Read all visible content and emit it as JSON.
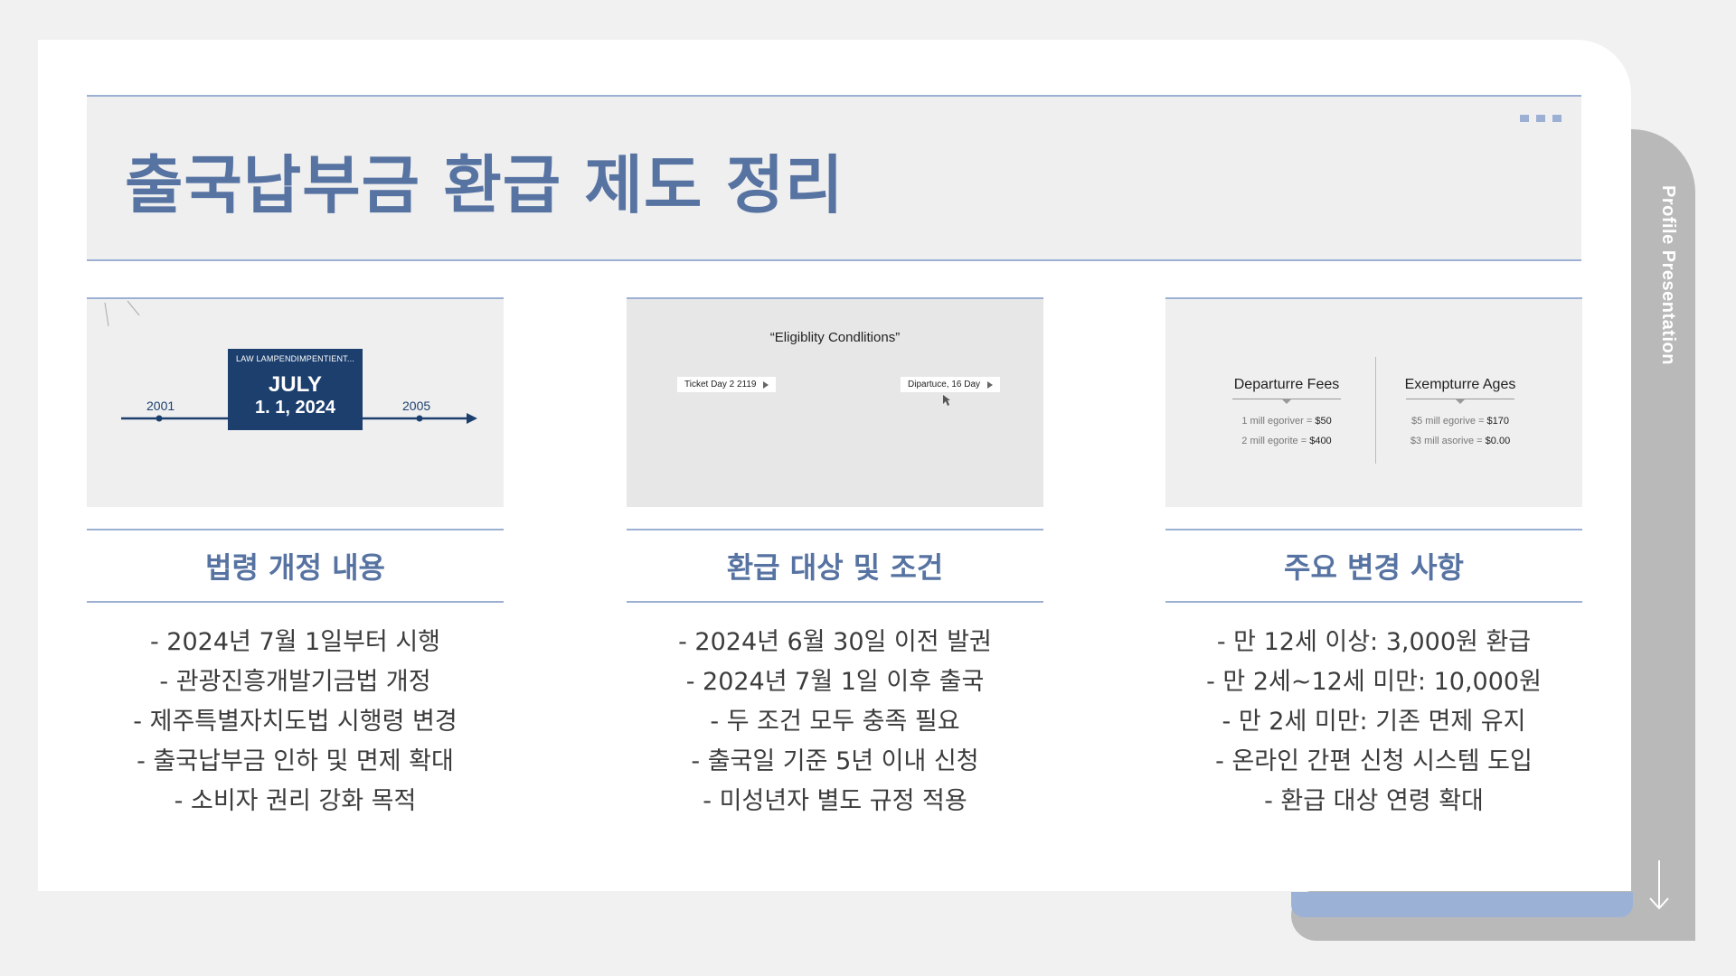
{
  "slide": {
    "title": "출국납부금 환급 제도 정리",
    "side_label": "Profile Presentation"
  },
  "columns": [
    {
      "heading": "법령 개정 내용",
      "items": [
        "- 2024년 7월 1일부터 시행",
        "- 관광진흥개발기금법 개정",
        "- 제주특별자치도법 시행령 변경",
        "- 출국납부금 인하 및 면제 확대",
        "- 소비자 권리 강화 목적"
      ],
      "thumbnail": {
        "box_top": "LAW LAMPENDIMPENTIENT...",
        "box_month": "JULY",
        "box_day": "1. 1, 2024",
        "year_left": "2001",
        "year_right": "2005"
      }
    },
    {
      "heading": "환급 대상 및 조건",
      "items": [
        "- 2024년 6월 30일 이전 발권",
        "- 2024년 7월 1일 이후 출국",
        "- 두 조건 모두 충족 필요",
        "- 출국일 기준 5년 이내 신청",
        "- 미성년자 별도 규정 적용"
      ],
      "thumbnail": {
        "quote": "“Eligiblity Condlitions”",
        "pill_left": "Ticket Day 2 2119",
        "pill_right": "Dipartuce, 16 Day"
      }
    },
    {
      "heading": "주요 변경 사항",
      "items": [
        "- 만 12세 이상: 3,000원 환급",
        "- 만 2세~12세 미만: 10,000원",
        "- 만 2세 미만: 기존 면제 유지",
        "- 온라인 간편 신청 시스템 도입",
        "- 환급 대상 연령 확대"
      ],
      "thumbnail": {
        "left_heading": "Departurre Fees",
        "left_rows": [
          {
            "label": "1 mill egoriver = ",
            "value": "$50"
          },
          {
            "label": "2 mill egorite = ",
            "value": "$400"
          }
        ],
        "right_heading": "Exempturre Ages",
        "right_rows": [
          {
            "label": "$5 mill egorive = ",
            "value": "$170"
          },
          {
            "label": "$3 mill asorive = ",
            "value": "$0.00"
          }
        ]
      }
    }
  ],
  "icons": {
    "dots": "three-dots-icon",
    "down_arrow": "arrow-down-icon",
    "cursor": "cursor-icon"
  },
  "colors": {
    "accent": "#5773a2",
    "rule": "#9cb0d4",
    "navy": "#1c3f6e",
    "side_tab": "#b9b9b9",
    "blue_tab": "#9bb2d6"
  }
}
